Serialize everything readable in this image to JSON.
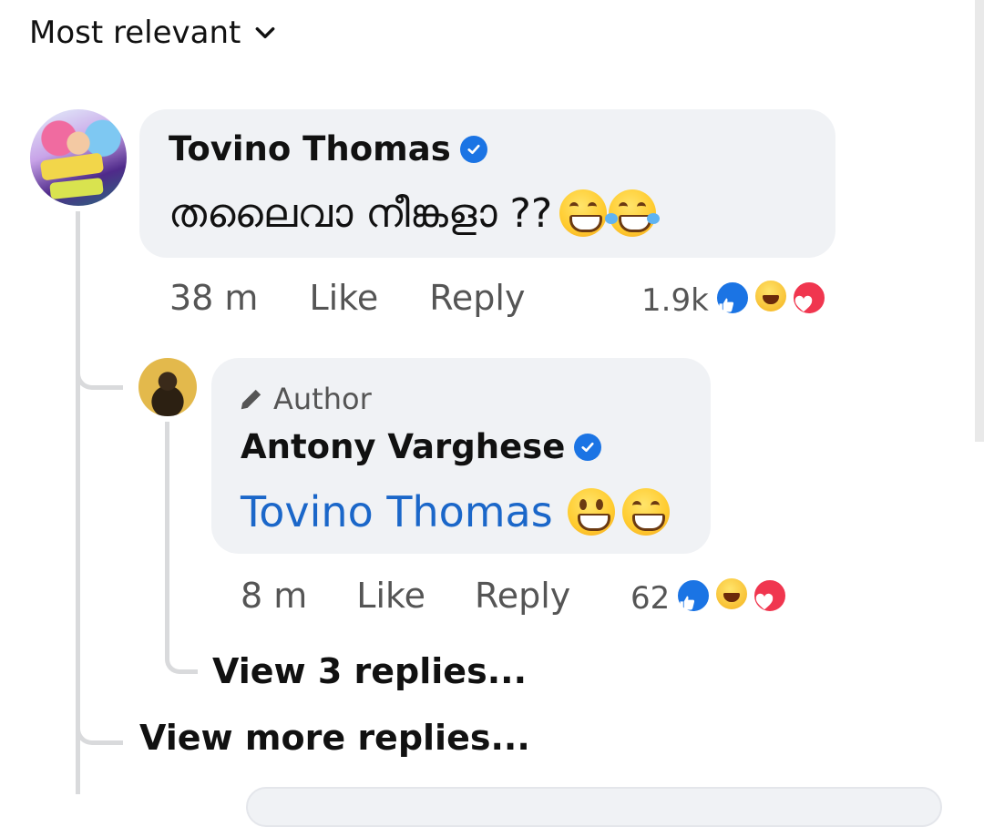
{
  "sort": {
    "label": "Most relevant"
  },
  "comment": {
    "author": "Tovino Thomas",
    "text": "തലൈവാ നീങ്കളാ ??",
    "time": "38 m",
    "like_label": "Like",
    "reply_label": "Reply",
    "reaction_count": "1.9k"
  },
  "reply": {
    "author_tag": "Author",
    "author": "Antony Varghese",
    "mention": "Tovino Thomas",
    "time": "8 m",
    "like_label": "Like",
    "reply_label": "Reply",
    "reaction_count": "62",
    "view_replies": "View 3 replies..."
  },
  "view_more": "View more replies..."
}
